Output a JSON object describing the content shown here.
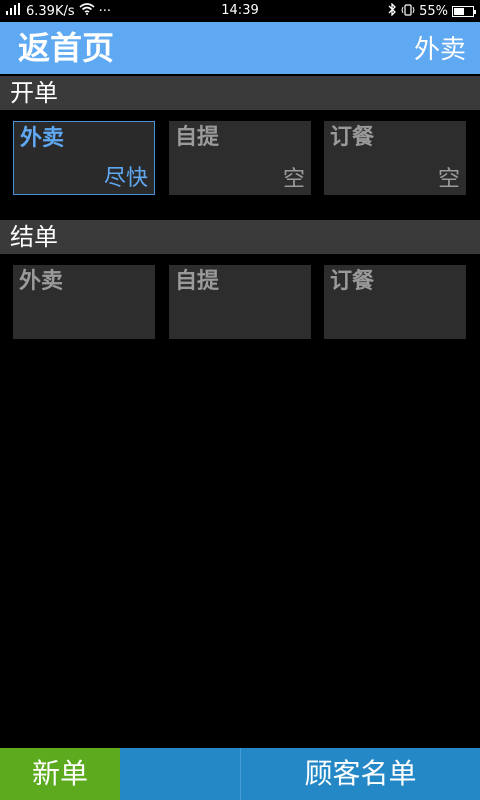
{
  "status_bar": {
    "network_speed": "6.39K/s",
    "more": "···",
    "time": "14:39",
    "battery": "55%",
    "battery_level": 0.55
  },
  "title_bar": {
    "back_label": "返首页",
    "mode_label": "外卖"
  },
  "open_orders": {
    "header": "开单",
    "tiles": [
      {
        "label": "外卖",
        "status": "尽快",
        "selected": true
      },
      {
        "label": "自提",
        "status": "空",
        "selected": false
      },
      {
        "label": "订餐",
        "status": "空",
        "selected": false
      }
    ]
  },
  "close_orders": {
    "header": "结单",
    "tiles": [
      {
        "label": "外卖"
      },
      {
        "label": "自提"
      },
      {
        "label": "订餐"
      }
    ]
  },
  "bottom_bar": {
    "new_order": "新单",
    "customer_list": "顾客名单"
  },
  "colors": {
    "accent": "#5fa8f2",
    "new_button": "#5cab1f",
    "bottom_bar": "#2488c6"
  }
}
